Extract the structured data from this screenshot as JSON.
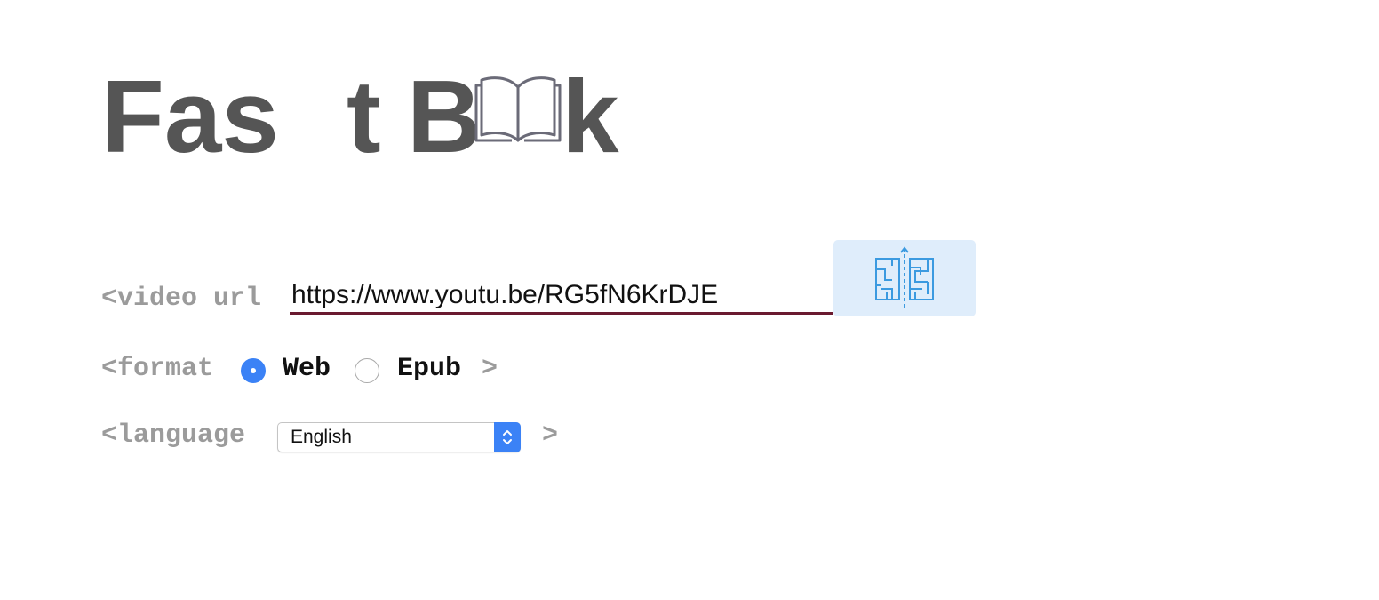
{
  "logo": {
    "part1": "Fas",
    "part2": "t",
    "part3": "B",
    "part4": "k",
    "icon": "open-book-icon"
  },
  "url_row": {
    "prefix": "<video url",
    "value": "https://www.youtu.be/RG5fN6KrDJE",
    "submit_icon": "maze-icon",
    "underline_color": "#6a1a30",
    "button_bg": "#dfedfb"
  },
  "format_row": {
    "prefix": "<format",
    "options": [
      {
        "label": "Web",
        "selected": true
      },
      {
        "label": "Epub",
        "selected": false
      }
    ],
    "suffix": ">",
    "accent": "#3b82f6"
  },
  "language_row": {
    "prefix": "<language",
    "selected": "English",
    "suffix": ">"
  }
}
